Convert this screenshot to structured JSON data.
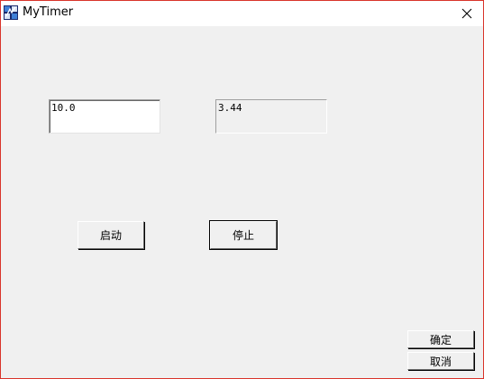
{
  "window": {
    "title": "MyTimer"
  },
  "icons": {
    "app": "app-icon",
    "close": "close-icon"
  },
  "colors": {
    "frame_border": "#d9342b",
    "client_bg": "#f0f0f0",
    "titlebar_bg": "#ffffff"
  },
  "form": {
    "interval_value": "10.0",
    "elapsed_value": "3.44",
    "start_label": "启动",
    "stop_label": "停止",
    "ok_label": "确定",
    "cancel_label": "取消"
  }
}
